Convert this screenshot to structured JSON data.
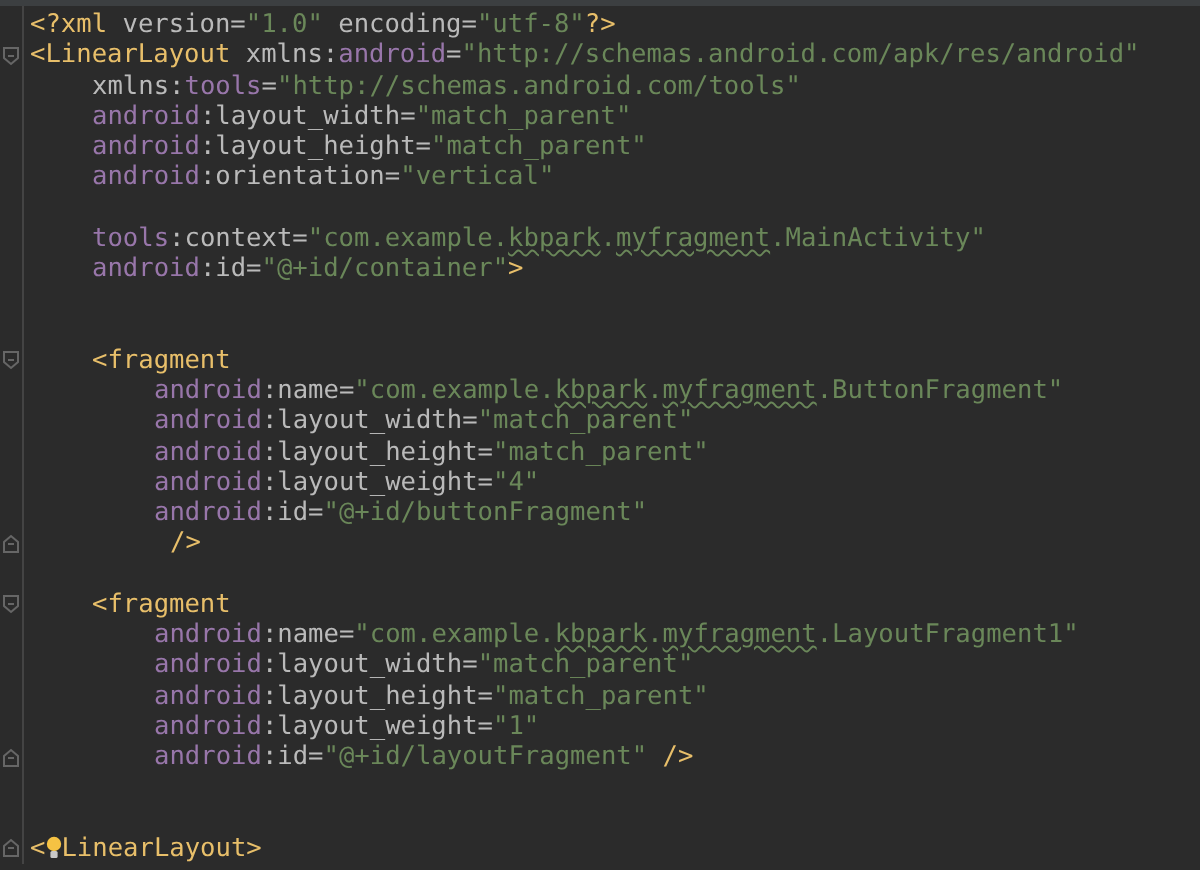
{
  "editor": {
    "lines": [
      {
        "kind": "code",
        "tokens": [
          {
            "kind": "tag",
            "text": "<?xml "
          },
          {
            "kind": "attr",
            "text": "version="
          },
          {
            "kind": "str",
            "text": "\"1.0\" "
          },
          {
            "kind": "attr",
            "text": "encoding="
          },
          {
            "kind": "str",
            "text": "\"utf-8\""
          },
          {
            "kind": "tag",
            "text": "?>"
          }
        ]
      },
      {
        "kind": "code",
        "fold_start": true,
        "tokens": [
          {
            "kind": "tag",
            "text": "<LinearLayout "
          },
          {
            "kind": "attr",
            "text": "xmlns:"
          },
          {
            "kind": "ns",
            "text": "android"
          },
          {
            "kind": "attr",
            "text": "="
          },
          {
            "kind": "str",
            "text": "\"http://schemas.android.com/apk/res/android\""
          }
        ],
        "children": [
          {
            "kind": "code",
            "tokens": [
              {
                "kind": "attr",
                "text": "xmlns:"
              },
              {
                "kind": "ns",
                "text": "tools"
              },
              {
                "kind": "attr",
                "text": "="
              },
              {
                "kind": "str",
                "text": "\"http://schemas.android.com/tools\""
              }
            ]
          },
          {
            "kind": "code",
            "tokens": [
              {
                "kind": "ns",
                "text": "android"
              },
              {
                "kind": "attr",
                "text": ":layout_width="
              },
              {
                "kind": "str",
                "text": "\"match_parent\""
              }
            ]
          },
          {
            "kind": "code",
            "tokens": [
              {
                "kind": "ns",
                "text": "android"
              },
              {
                "kind": "attr",
                "text": ":layout_height="
              },
              {
                "kind": "str",
                "text": "\"match_parent\""
              }
            ]
          },
          {
            "kind": "code",
            "tokens": [
              {
                "kind": "ns",
                "text": "android"
              },
              {
                "kind": "attr",
                "text": ":orientation="
              },
              {
                "kind": "str",
                "text": "\"vertical\""
              }
            ]
          },
          {
            "kind": "blank"
          },
          {
            "kind": "code",
            "tokens": [
              {
                "kind": "ns",
                "text": "tools"
              },
              {
                "kind": "attr",
                "text": ":context="
              },
              {
                "kind": "str",
                "text": "\"com.example."
              },
              {
                "kind": "typo",
                "text": "kbpark"
              },
              {
                "kind": "str",
                "text": "."
              },
              {
                "kind": "typo",
                "text": "myfragment"
              },
              {
                "kind": "str",
                "text": ".MainActivity\""
              }
            ]
          },
          {
            "kind": "code",
            "tokens": [
              {
                "kind": "ns",
                "text": "android"
              },
              {
                "kind": "attr",
                "text": ":id="
              },
              {
                "kind": "str",
                "text": "\"@+id/container\""
              },
              {
                "kind": "tag",
                "text": ">"
              }
            ]
          },
          {
            "kind": "blank"
          },
          {
            "kind": "blank"
          },
          {
            "kind": "code",
            "fold_start": true,
            "tokens": [
              {
                "kind": "tag",
                "text": "<fragment"
              }
            ],
            "children": [
              {
                "kind": "code",
                "tokens": [
                  {
                    "kind": "ns",
                    "text": "android"
                  },
                  {
                    "kind": "attr",
                    "text": ":name="
                  },
                  {
                    "kind": "str",
                    "text": "\"com.example."
                  },
                  {
                    "kind": "typo",
                    "text": "kbpark"
                  },
                  {
                    "kind": "str",
                    "text": "."
                  },
                  {
                    "kind": "typo",
                    "text": "myfragment"
                  },
                  {
                    "kind": "str",
                    "text": ".ButtonFragment\""
                  }
                ]
              },
              {
                "kind": "code",
                "tokens": [
                  {
                    "kind": "ns",
                    "text": "android"
                  },
                  {
                    "kind": "attr",
                    "text": ":layout_width="
                  },
                  {
                    "kind": "str",
                    "text": "\"match_parent\""
                  }
                ]
              },
              {
                "kind": "code",
                "tokens": [
                  {
                    "kind": "ns",
                    "text": "android"
                  },
                  {
                    "kind": "attr",
                    "text": ":layout_height="
                  },
                  {
                    "kind": "str",
                    "text": "\"match_parent\""
                  }
                ]
              },
              {
                "kind": "code",
                "tokens": [
                  {
                    "kind": "ns",
                    "text": "android"
                  },
                  {
                    "kind": "attr",
                    "text": ":layout_weight="
                  },
                  {
                    "kind": "str",
                    "text": "\"4\""
                  }
                ]
              },
              {
                "kind": "code",
                "tokens": [
                  {
                    "kind": "ns",
                    "text": "android"
                  },
                  {
                    "kind": "attr",
                    "text": ":id="
                  },
                  {
                    "kind": "str",
                    "text": "\"@+id/buttonFragment\""
                  }
                ]
              },
              {
                "kind": "code",
                "fold_end": true,
                "tokens": [
                  {
                    "kind": "close_tag",
                    "text": "/>"
                  }
                ]
              }
            ]
          },
          {
            "kind": "blank"
          },
          {
            "kind": "code",
            "fold_start": true,
            "tokens": [
              {
                "kind": "tag",
                "text": "<fragment"
              }
            ],
            "children": [
              {
                "kind": "code",
                "tokens": [
                  {
                    "kind": "ns",
                    "text": "android"
                  },
                  {
                    "kind": "attr",
                    "text": ":name="
                  },
                  {
                    "kind": "str",
                    "text": "\"com.example."
                  },
                  {
                    "kind": "typo",
                    "text": "kbpark"
                  },
                  {
                    "kind": "str",
                    "text": "."
                  },
                  {
                    "kind": "typo",
                    "text": "myfragment"
                  },
                  {
                    "kind": "str",
                    "text": ".LayoutFragment1\""
                  }
                ]
              },
              {
                "kind": "code",
                "tokens": [
                  {
                    "kind": "ns",
                    "text": "android"
                  },
                  {
                    "kind": "attr",
                    "text": ":layout_width="
                  },
                  {
                    "kind": "str",
                    "text": "\"match_parent\""
                  }
                ]
              },
              {
                "kind": "code",
                "tokens": [
                  {
                    "kind": "ns",
                    "text": "android"
                  },
                  {
                    "kind": "attr",
                    "text": ":layout_height="
                  },
                  {
                    "kind": "str",
                    "text": "\"match_parent\""
                  }
                ]
              },
              {
                "kind": "code",
                "tokens": [
                  {
                    "kind": "ns",
                    "text": "android"
                  },
                  {
                    "kind": "attr",
                    "text": ":layout_weight="
                  },
                  {
                    "kind": "str",
                    "text": "\"1\""
                  }
                ]
              },
              {
                "kind": "code",
                "fold_end": true,
                "tokens": [
                  {
                    "kind": "ns",
                    "text": "android"
                  },
                  {
                    "kind": "attr",
                    "text": ":id="
                  },
                  {
                    "kind": "str",
                    "text": "\"@+id/layoutFragment\" "
                  },
                  {
                    "kind": "tag",
                    "text": "/>"
                  }
                ]
              }
            ]
          },
          {
            "kind": "blank"
          },
          {
            "kind": "blank"
          }
        ]
      },
      {
        "kind": "code",
        "fold_end": true,
        "tokens": [
          {
            "kind": "tag",
            "text": "<"
          },
          {
            "kind": "bulb"
          },
          {
            "kind": "tag",
            "text": "LinearLayout>"
          }
        ]
      }
    ]
  }
}
